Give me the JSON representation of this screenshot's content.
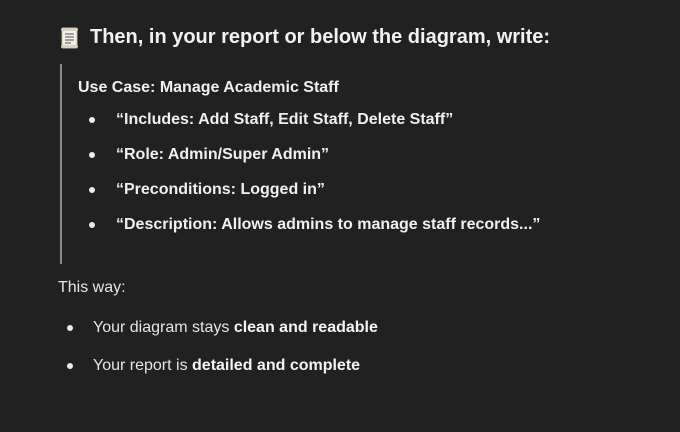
{
  "heading": {
    "icon": "page-with-lines-icon",
    "text": "Then, in your report or below the diagram, write:"
  },
  "quote": {
    "title": "Use Case: Manage Academic Staff",
    "items": [
      "“Includes: Add Staff, Edit Staff, Delete Staff”",
      "“Role: Admin/Super Admin”",
      "“Preconditions: Logged in”",
      "“Description: Allows admins to manage staff records...”"
    ]
  },
  "intro": "This way:",
  "points": [
    {
      "prefix": "Your diagram stays ",
      "bold": "clean and readable"
    },
    {
      "prefix": "Your report is ",
      "bold": "detailed and complete"
    }
  ],
  "colors": {
    "background": "#212121",
    "text": "#ececec",
    "quote_border": "#8a8a8a"
  }
}
